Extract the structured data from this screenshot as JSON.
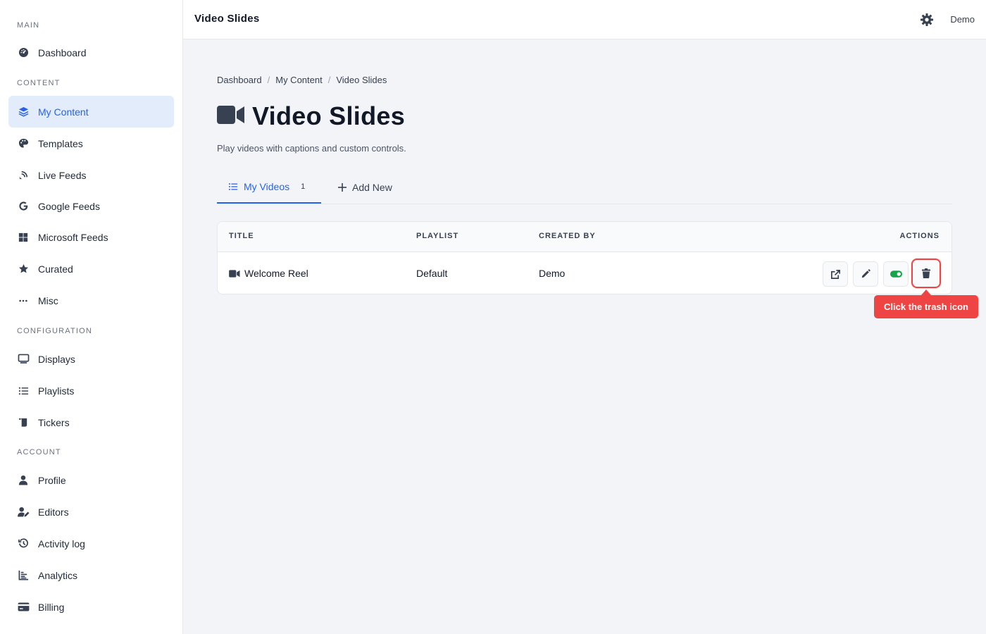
{
  "sidebar": {
    "sections": {
      "main": "MAIN",
      "content": "CONTENT",
      "configuration": "CONFIGURATION",
      "account": "ACCOUNT"
    },
    "items": [
      {
        "label": "Dashboard",
        "icon": "dashboard-icon"
      },
      {
        "label": "My Content",
        "icon": "layers-icon",
        "active": true
      },
      {
        "label": "Templates",
        "icon": "palette-icon"
      },
      {
        "label": "Live Feeds",
        "icon": "satellite-dish-icon"
      },
      {
        "label": "Google Feeds",
        "icon": "google-icon"
      },
      {
        "label": "Microsoft Feeds",
        "icon": "windows-icon"
      },
      {
        "label": "Curated",
        "icon": "star-icon"
      },
      {
        "label": "Misc",
        "icon": "ellipsis-icon"
      },
      {
        "label": "Displays",
        "icon": "monitor-icon"
      },
      {
        "label": "Playlists",
        "icon": "list-icon"
      },
      {
        "label": "Tickers",
        "icon": "scroll-icon"
      },
      {
        "label": "Profile",
        "icon": "user-icon"
      },
      {
        "label": "Editors",
        "icon": "user-edit-icon"
      },
      {
        "label": "Activity log",
        "icon": "history-icon"
      },
      {
        "label": "Analytics",
        "icon": "chart-icon"
      },
      {
        "label": "Billing",
        "icon": "credit-card-icon"
      }
    ]
  },
  "topbar": {
    "title": "Video Slides",
    "user": "Demo"
  },
  "breadcrumb": [
    "Dashboard",
    "My Content",
    "Video Slides"
  ],
  "breadcrumb_sep": "/",
  "page": {
    "title": "Video Slides",
    "subtitle": "Play videos with captions and custom controls."
  },
  "tabs": {
    "my_videos": "My Videos",
    "my_videos_count": "1",
    "add_new": "Add New"
  },
  "table": {
    "headers": {
      "title": "TITLE",
      "playlist": "PLAYLIST",
      "created_by": "CREATED BY",
      "actions": "ACTIONS"
    },
    "rows": [
      {
        "title": "Welcome Reel",
        "playlist": "Default",
        "created_by": "Demo"
      }
    ]
  },
  "tooltip": "Click the trash icon",
  "colors": {
    "accent": "#2563eb",
    "active_bg": "#e3ecfb",
    "highlight": "#ef4444",
    "toggle_on": "#16a34a"
  }
}
